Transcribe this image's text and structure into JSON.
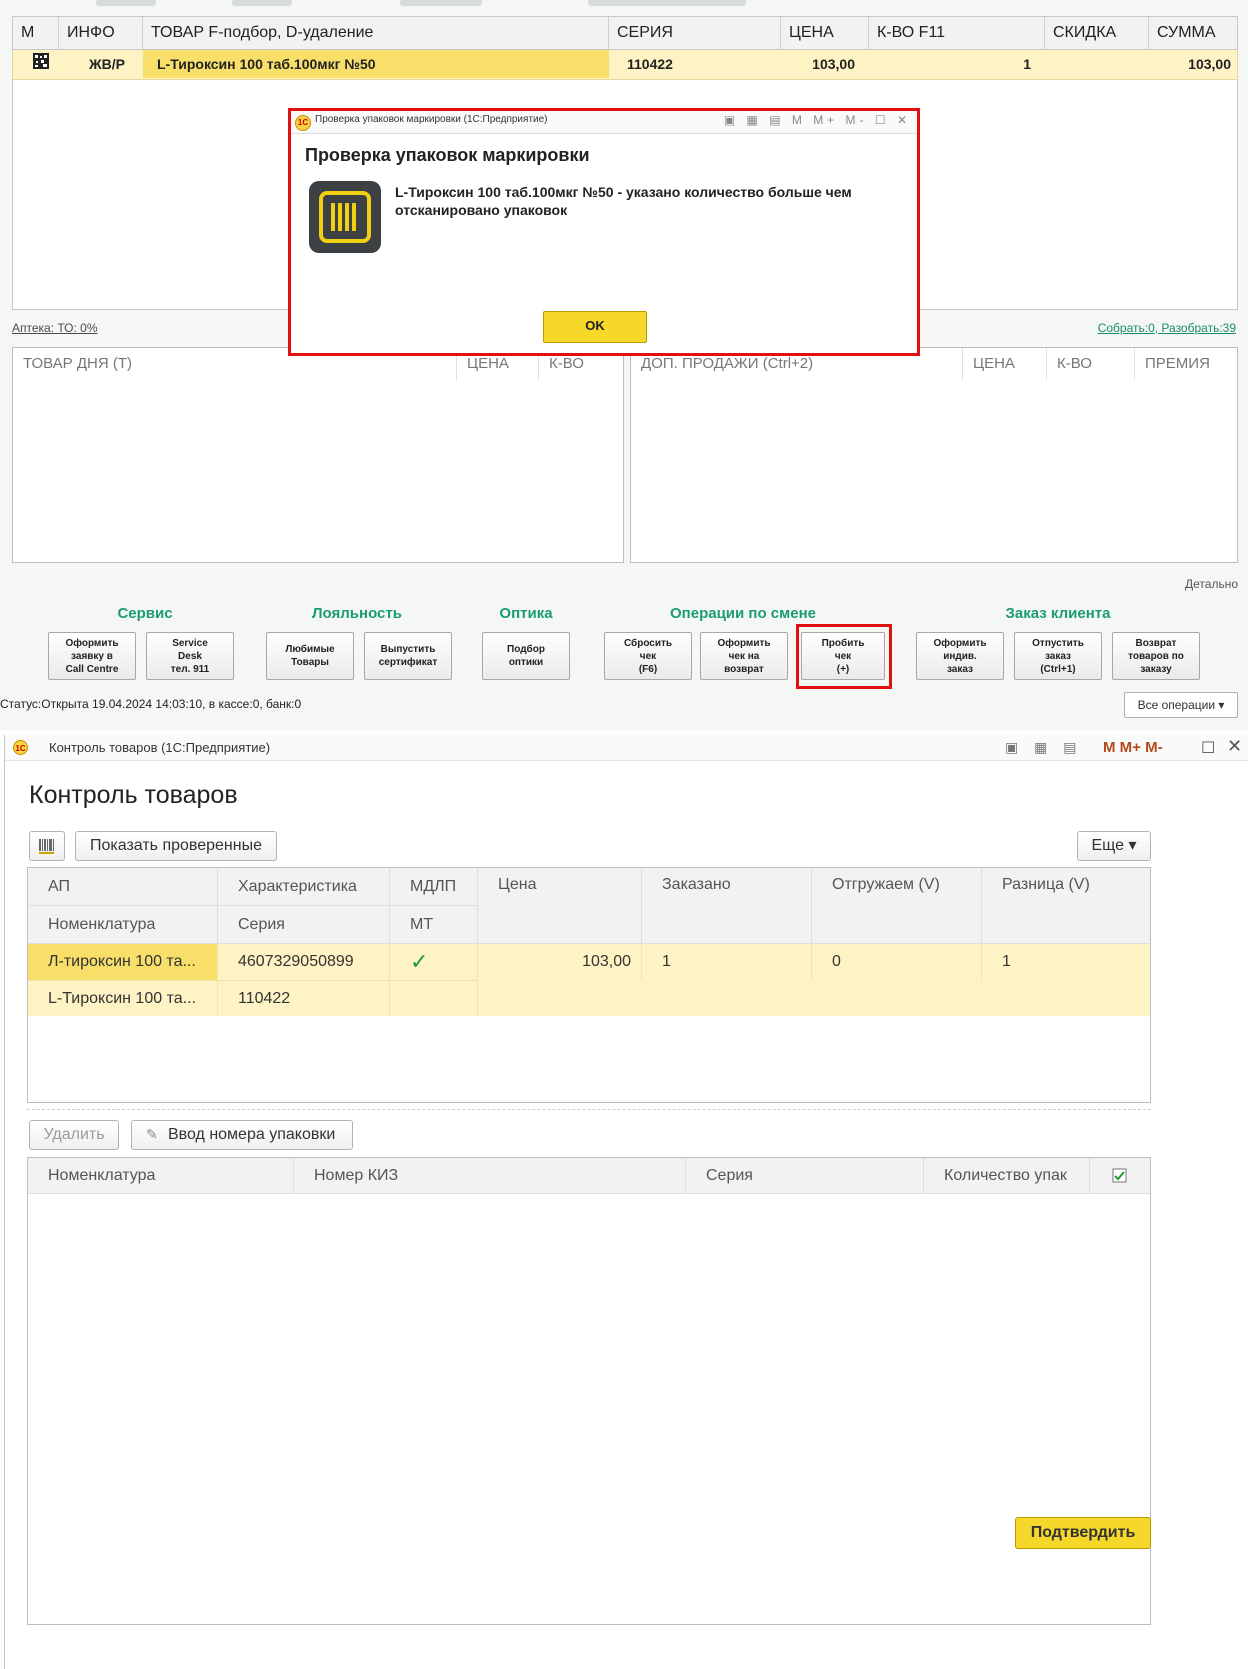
{
  "pos": {
    "columns": [
      "М",
      "ИНФО",
      "ТОВАР  F-подбор, D-удаление",
      "СЕРИЯ",
      "ЦЕНА",
      "К-ВО F11",
      "СКИДКА",
      "СУММА"
    ],
    "row": {
      "info": "ЖВ/Р",
      "product": "L-Тироксин 100 таб.100мкг №50",
      "series": "110422",
      "price": "103,00",
      "qty": "1",
      "discount": "",
      "sum": "103,00"
    },
    "pharmacy_link": "Аптека: ТО: 0%",
    "collect_link": "Собрать:0, Разобрать:39",
    "left_panel": {
      "headers": [
        "ТОВАР ДНЯ (Т)",
        "ЦЕНА",
        "К-ВО"
      ]
    },
    "right_panel": {
      "headers": [
        "ДОП. ПРОДАЖИ (Ctrl+2)",
        "ЦЕНА",
        "К-ВО",
        "ПРЕМИЯ"
      ]
    },
    "detail_label": "Детально",
    "groups": {
      "service": "Сервис",
      "loyalty": "Лояльность",
      "optics": "Оптика",
      "shift_ops": "Операции по смене",
      "client_order": "Заказ клиента"
    },
    "buttons": {
      "call_centre": "Оформить\nзаявку в\nCall Centre",
      "service_desk": "Service\nDesk\nтел. 911",
      "favorites": "Любимые\nТовары",
      "certificate": "Выпустить\nсертификат",
      "optics_select": "Подбор\nоптики",
      "reset_receipt": "Сбросить\nчек\n(F6)",
      "return_receipt": "Оформить\nчек на\nвозврат",
      "punch_receipt": "Пробить\nчек\n(+)",
      "individual_order": "Оформить\nиндив.\nзаказ",
      "release_order": "Отпустить\nзаказ\n(Ctrl+1)",
      "order_return": "Возврат\nтоваров по\nзаказу"
    },
    "status": "Статус:Открыта 19.04.2024 14:03:10, в кассе:0, банк:0",
    "all_operations": "Все операции ▾"
  },
  "dialog": {
    "window_title": "Проверка упаковок маркировки  (1С:Предприятие)",
    "title": "Проверка упаковок маркировки",
    "message": "L-Тироксин 100 таб.100мкг №50 - указано количество больше чем отсканировано упаковок",
    "ok_label": "OK",
    "logo_text": "1С",
    "toolbar_icons": "▣ ▦ ▤ M M+ M- ☐ ✕"
  },
  "control": {
    "window_title": "Контроль товаров  (1С:Предприятие)",
    "logo_text": "1С",
    "toolbar_icons": "▣ ▦ ▤",
    "mem_icons": "M  M+  M-",
    "title": "Контроль товаров",
    "show_checked": "Показать проверенные",
    "more": "Еще ▾",
    "grid_headers": {
      "ap": "АП",
      "characteristic": "Характеристика",
      "mdlp": "МДЛП",
      "price": "Цена",
      "ordered": "Заказано",
      "shipping": "Отгружаем (V)",
      "diff": "Разница (V)",
      "nomenclature": "Номенклатура",
      "series": "Серия",
      "mt": "МТ"
    },
    "row": {
      "ap": "Л-тироксин 100 та...",
      "characteristic": "4607329050899",
      "mdlp": "✓",
      "price": "103,00",
      "ordered": "1",
      "shipping": "0",
      "diff": "1",
      "nomenclature": "L-Тироксин 100 та...",
      "series": "110422"
    },
    "delete_label": "Удалить",
    "package_entry_label": "Ввод номера упаковки",
    "lower_headers": [
      "Номенклатура",
      "Номер КИЗ",
      "Серия",
      "Количество упак"
    ],
    "confirm_label": "Подтвердить"
  }
}
